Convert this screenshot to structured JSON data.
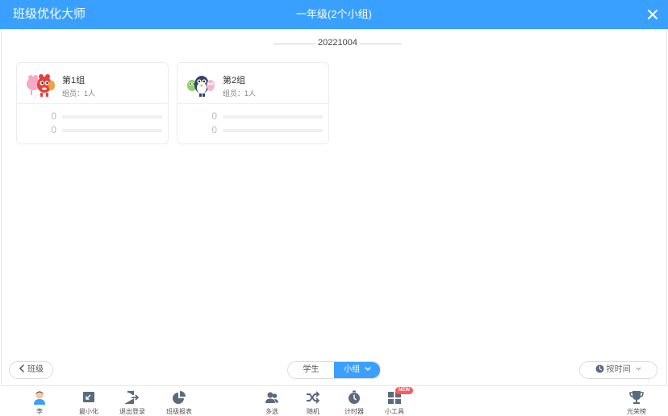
{
  "app": {
    "name": "班级优化大师",
    "window_title": "一年级(2个小组)"
  },
  "date_label": "20221004",
  "groups": [
    {
      "name": "第1组",
      "members": "组员：1人",
      "stat1": "0",
      "stat2": "0"
    },
    {
      "name": "第2组",
      "members": "组员：1人",
      "stat1": "0",
      "stat2": "0"
    }
  ],
  "nav": {
    "back_label": "班级",
    "tab_student": "学生",
    "tab_group": "小组",
    "sort_label": "按时间"
  },
  "toolbar": {
    "user_label": "李",
    "minimize_label": "最小化",
    "logout_label": "退出登录",
    "report_label": "班级报表",
    "multiselect_label": "多选",
    "random_label": "随机",
    "timer_label": "计时器",
    "tools_label": "小工具",
    "tools_badge": "NEW",
    "honor_label": "光荣榜"
  },
  "colors": {
    "accent": "#3aa0ff",
    "toolbar_icon": "#5a6b7d",
    "badge": "#ff5a5a"
  }
}
